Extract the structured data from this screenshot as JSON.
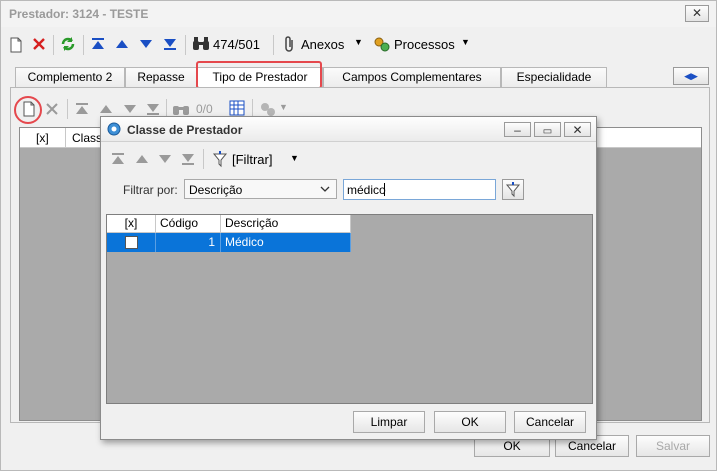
{
  "main_window": {
    "title": "Prestador: 3124 - TESTE",
    "close_glyph": "✕",
    "toolbar": {
      "record_counter": "474/501",
      "anexos_label": "Anexos",
      "processos_label": "Processos",
      "icons": [
        "new-doc-icon",
        "delete-icon",
        "refresh-icon",
        "first-icon",
        "prev-icon",
        "next-icon",
        "last-icon",
        "binoculars-icon",
        "paperclip-icon",
        "gears-icon"
      ]
    },
    "tabs": [
      "Complemento 2",
      "Repasse",
      "Tipo de Prestador",
      "Campos Complementares",
      "Especialidade"
    ],
    "active_tab": "Tipo de Prestador",
    "highlight_color": "#e5484d",
    "inner_toolbar": {
      "counter": "0/0"
    },
    "grid_headers": [
      "[x]",
      "Classe"
    ],
    "footer": {
      "ok": "OK",
      "cancel": "Cancelar",
      "save": "Salvar"
    }
  },
  "dialog": {
    "title": "Classe de Prestador",
    "toolbar": {
      "filter_label": "[Filtrar]"
    },
    "filter": {
      "label": "Filtrar por:",
      "field_value": "Descrição",
      "search_value": "médico"
    },
    "grid": {
      "headers": [
        "[x]",
        "Código",
        "Descrição"
      ],
      "rows": [
        {
          "checked": false,
          "codigo": "1",
          "descricao": "Médico"
        }
      ]
    },
    "buttons": {
      "clear": "Limpar",
      "ok": "OK",
      "cancel": "Cancelar"
    },
    "selection_color": "#0a74d9"
  }
}
